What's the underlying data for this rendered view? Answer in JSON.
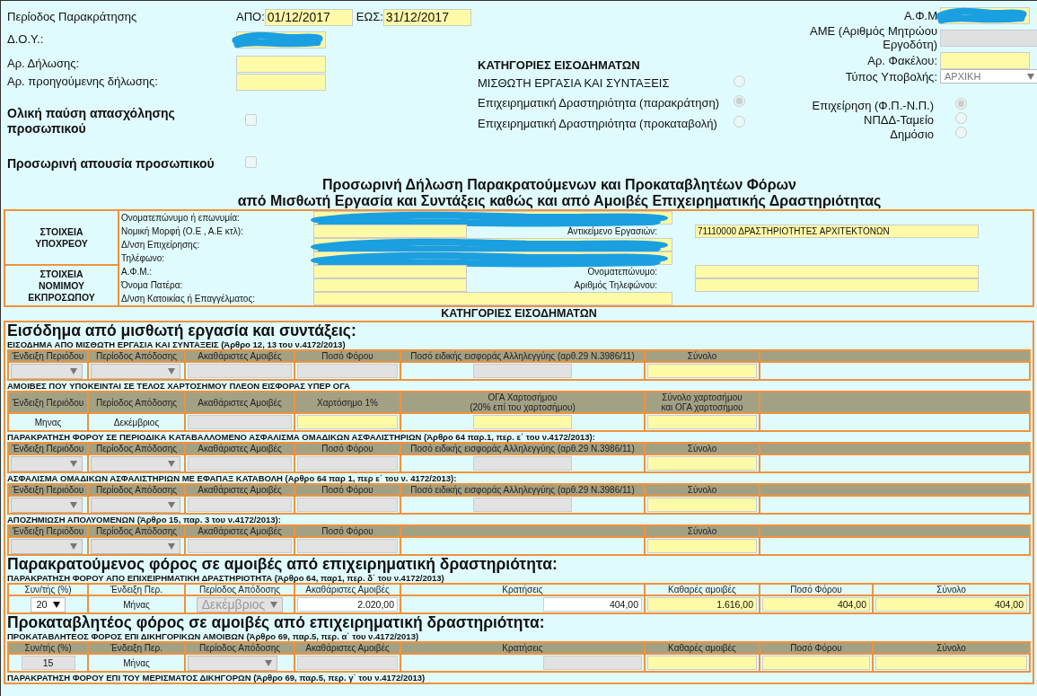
{
  "header": {
    "period": {
      "label": "Περίοδος Παρακράτησης",
      "from_label": "ΑΠΟ:",
      "from": "01/12/2017",
      "to_label": "ΕΩΣ:",
      "to": "31/12/2017"
    },
    "left_fields": [
      {
        "label": "Δ.Ο.Υ.:",
        "redacted": true
      },
      {
        "label": "Αρ. Δήλωσης:",
        "redacted": false
      },
      {
        "label": "Αρ. προηγούμενης δήλωσης:",
        "redacted": false
      }
    ],
    "checks": [
      {
        "label": "Ολική παύση απασχόλησης προσωπικού",
        "checked": false,
        "disabled": true
      },
      {
        "label": "Προσωρινή απουσία προσωπικού",
        "checked": false,
        "disabled": true
      }
    ],
    "categories": {
      "title": "ΚΑΤΗΓΟΡΙΕΣ ΕΙΣΟΔΗΜΑΤΩΝ",
      "options": [
        {
          "label": "ΜΙΣΘΩΤΗ ΕΡΓΑΣΙΑ ΚΑΙ ΣΥΝΤΑΞΕΙΣ",
          "selected": false,
          "disabled": true
        },
        {
          "label": "Επιχειρηματική Δραστηριότητα (παρακράτηση)",
          "selected": true,
          "disabled": true
        },
        {
          "label": "Επιχειρηματική Δραστηριότητα (προκαταβολή)",
          "selected": false,
          "disabled": true
        }
      ]
    },
    "right_fields": [
      {
        "label": "Α.Φ.Μ",
        "kind": "input",
        "redacted": true,
        "disabled": false
      },
      {
        "label": "ΑΜΕ (Αριθμός Μητρώου Εργοδότη)",
        "kind": "input",
        "redacted": false,
        "disabled": true
      },
      {
        "label": "Αρ. Φακέλου:",
        "kind": "input",
        "redacted": false,
        "disabled": false
      },
      {
        "label": "Τύπος Υποβολής:",
        "kind": "select",
        "value": "ΑΡΧΙΚΗ",
        "disabled": true
      }
    ],
    "entity_types": [
      {
        "label": "Επιχείρηση (Φ.Π.-Ν.Π.)",
        "selected": true,
        "disabled": true
      },
      {
        "label": "ΝΠΔΔ-Ταμείο",
        "selected": false,
        "disabled": true
      },
      {
        "label": "Δημόσιο",
        "selected": false,
        "disabled": true
      }
    ]
  },
  "title_lines": [
    "Προσωρινή Δήλωση Παρακρατούμενων και Προκαταβλητέων Φόρων",
    "από Μισθωτή Εργασία και Συντάξεις καθώς και από Αμοιβές Επιχειρηματικής Δραστηριότητας"
  ],
  "parties": [
    {
      "heading": "ΣΤΟΙΧΕΙΑ ΥΠΟΧΡΕΟΥ",
      "rows": [
        {
          "label": "Ονοματεπώνυμο ή επωνυμία:",
          "redacted": true
        },
        {
          "label": "Νομική Μορφή (Ο.Ε , Α.Ε κτλ):",
          "redacted": false,
          "label2": "Αντικείμενο Εργασιών:",
          "value2": "71110000 ΔΡΑΣΤΗΡΙΟΤΗΤΕΣ ΑΡΧΙΤΕΚΤΟΝΩΝ"
        },
        {
          "label": "Δ/νση Επιχείρησης:",
          "redacted": true
        },
        {
          "label": "Τηλέφωνο:",
          "redacted": true
        }
      ]
    },
    {
      "heading": "ΣΤΟΙΧΕΙΑ ΝΟΜΙΜΟΥ ΕΚΠΡΟΣΩΠΟΥ",
      "rows": [
        {
          "label": "Α.Φ.Μ.:",
          "redacted": false,
          "label2": "Ονοματεπώνυμο:"
        },
        {
          "label": "Όνομα Πατέρα:",
          "redacted": false,
          "label2": "Αριθμός Τηλεφώνου:"
        },
        {
          "label": "Δ/νση Κατοικίας ή Επαγγέλματος:",
          "redacted": false
        }
      ]
    }
  ],
  "income": {
    "title": "ΚΑΤΗΓΟΡΙΕΣ ΕΙΣΟΔΗΜΑΤΩΝ",
    "groups": [
      {
        "title": "Εισόδημα από μισθωτή εργασία και συντάξεις:",
        "sections": [
          {
            "caption": "ΕΙΣΟΔΗΜΑ ΑΠΟ ΜΙΣΘΩΤΗ ΕΡΓΑΣΙΑ ΚΑΙ ΣΥΝΤΑΞΕΙΣ (Άρθρο 12, 13 του ν.4172/2013)",
            "header_shaded": true,
            "columns": [
              "Ένδειξη Περιόδου",
              "Περίοδος Απόδοσης",
              "Ακαθάριστες Αμοιβές",
              "Ποσό Φόρου",
              "Ποσό ειδικής εισφοράς Αλληλεγγύης (αρθ.29 Ν.3986/11)",
              "Σύνολο"
            ],
            "cells": [
              {
                "kind": "select",
                "disabled": true
              },
              {
                "kind": "select",
                "disabled": true
              },
              {
                "kind": "input",
                "disabled": true,
                "highlighted": false
              },
              {
                "kind": "input",
                "disabled": true,
                "highlighted": false
              },
              {
                "kind": "input",
                "disabled": true,
                "highlighted": false
              },
              {
                "kind": "input",
                "disabled": false,
                "highlighted": true
              }
            ]
          },
          {
            "caption": "ΑΜΟΙΒΕΣ ΠΟΥ ΥΠΟΚΕΙΝΤΑΙ ΣΕ ΤΕΛΟΣ ΧΑΡΤΟΣΗΜΟΥ ΠΛΕΟΝ ΕΙΣΦΟΡΑΣ ΥΠΕΡ ΟΓΑ",
            "header_shaded": true,
            "columns": [
              "Ένδειξη Περιόδου",
              "Περίοδος Απόδοσης",
              "Ακαθάριστες Αμοιβές",
              "Χαρτόσημο 1%",
              "ΟΓΑ Χαρτοσήμου\n(20% επί του χαρτοσήμου)",
              "Σύνολο χαρτοσήμου\nκαι ΟΓΑ χαρτοσήμου"
            ],
            "cells": [
              {
                "kind": "text",
                "value": "Μηνας"
              },
              {
                "kind": "text",
                "value": "Δεκέμβριος"
              },
              {
                "kind": "input",
                "disabled": true,
                "highlighted": false
              },
              {
                "kind": "input",
                "disabled": false,
                "highlighted": true
              },
              {
                "kind": "input",
                "disabled": false,
                "highlighted": true
              },
              {
                "kind": "input",
                "disabled": false,
                "highlighted": true
              }
            ]
          },
          {
            "caption": "ΠΑΡΑΚΡΑΤΗΣΗ ΦΟΡΟΥ ΣΕ ΠΕΡΙΟΔΙΚΑ ΚΑΤΑΒΑΛΛΟΜΕΝΟ ΑΣΦΑΛΙΣΜΑ ΟΜΑΔΙΚΩΝ ΑΣΦΑΛΙΣΤΗΡΙΩΝ (Άρθρο 64 παρ.1, περ. ε΄ του ν.4172/2013):",
            "header_shaded": true,
            "columns": [
              "Ένδειξη Περιόδου",
              "Περίοδος Απόδοσης",
              "Ακαθάριστες Αμοιβές",
              "Ποσό Φόρου",
              "Ποσό ειδικής εισφοράς Αλληλεγγύης (αρθ.29 Ν.3986/11)",
              "Σύνολο"
            ],
            "cells": [
              {
                "kind": "select",
                "disabled": true
              },
              {
                "kind": "select",
                "disabled": true
              },
              {
                "kind": "input",
                "disabled": true,
                "highlighted": false
              },
              {
                "kind": "input",
                "disabled": true,
                "highlighted": false
              },
              {
                "kind": "input",
                "disabled": true,
                "highlighted": false
              },
              {
                "kind": "input",
                "disabled": false,
                "highlighted": true
              }
            ]
          },
          {
            "caption": "ΑΣΦΑΛΙΣΜΑ ΟΜΑΔΙΚΩΝ ΑΣΦΑΛΙΣΤΗΡΙΩΝ ΜΕ ΕΦΑΠΑΞ ΚΑΤΑΒΟΛΗ (Αρθρο 64 παρ 1, περ ε΄ του ν. 4172/2013):",
            "header_shaded": true,
            "columns": [
              "Ένδειξη Περιόδου",
              "Περίοδος Απόδοσης",
              "Ακαθάριστες Αμοιβές",
              "Ποσό Φόρου",
              "Ποσό ειδικής εισφοράς Αλληλεγγύης (αρθ.29 Ν.3986/11)",
              "Σύνολο"
            ],
            "cells": [
              {
                "kind": "select",
                "disabled": true
              },
              {
                "kind": "select",
                "disabled": true
              },
              {
                "kind": "input",
                "disabled": true,
                "highlighted": false
              },
              {
                "kind": "input",
                "disabled": true,
                "highlighted": false
              },
              {
                "kind": "input",
                "disabled": true,
                "highlighted": false
              },
              {
                "kind": "input",
                "disabled": false,
                "highlighted": true
              }
            ]
          },
          {
            "caption": "ΑΠΟΖΗΜΙΩΣΗ ΑΠΟΛΥΟΜΕΝΩΝ (Άρθρο 15, παρ. 3 του ν.4172/2013):",
            "header_shaded": true,
            "columns": [
              "Ένδειξη Περιόδου",
              "Περίοδος Απόδοσης",
              "Ακαθάριστες Αμοιβές",
              "Ποσό Φόρου",
              null,
              "Σύνολο"
            ],
            "cells": [
              {
                "kind": "select",
                "disabled": true
              },
              {
                "kind": "select",
                "disabled": true
              },
              {
                "kind": "input",
                "disabled": true,
                "highlighted": false
              },
              {
                "kind": "input",
                "disabled": true,
                "highlighted": false
              },
              {
                "kind": "none"
              },
              {
                "kind": "input",
                "disabled": false,
                "highlighted": true
              }
            ]
          }
        ]
      },
      {
        "title": "Παρακρατούμενος φόρος σε αμοιβές από επιχειρηματική δραστηριότητα:",
        "sections": [
          {
            "caption": "ΠΑΡΑΚΡΑΤΗΣΗ ΦΟΡΟΥ ΑΠΟ ΕΠΙΧΕΙΡΗΜΑΤΙΚΗ ΔΡΑΣΤΗΡΙΟΤΗΤΑ (Άρθρο 64, παρ1, περ. δ΄ του ν.4172/2013)",
            "header_shaded": false,
            "columns": [
              "Συν/τής (%)",
              "Ένδειξη Περ.",
              "Περίοδος Απόδοσης",
              "Ακαθάριστες Αμοιβές",
              "Κρατήσεις",
              "Καθαρές αμοιβές",
              "Ποσό Φόρου",
              "Σύνολο"
            ],
            "cells": [
              {
                "kind": "select",
                "disabled": false,
                "value": "20"
              },
              {
                "kind": "text",
                "value": "Μήνας"
              },
              {
                "kind": "select",
                "disabled": true,
                "value": "Δεκέμβριος"
              },
              {
                "kind": "input",
                "disabled": false,
                "highlighted": false,
                "value": "2.020,00"
              },
              {
                "kind": "input",
                "disabled": false,
                "highlighted": false,
                "value": "404,00"
              },
              {
                "kind": "input",
                "disabled": false,
                "highlighted": true,
                "value": "1.616,00"
              },
              {
                "kind": "input",
                "disabled": false,
                "highlighted": true,
                "value": "404,00"
              },
              {
                "kind": "input",
                "disabled": false,
                "highlighted": true,
                "value": "404,00"
              }
            ]
          }
        ]
      },
      {
        "title": "Προκαταβλητέος φόρος σε αμοιβές από επιχειρηματική δραστηριότητα:",
        "sections": [
          {
            "caption": "ΠΡΟΚΑΤΑΒΛΗΤΕΟΣ ΦΟΡΟΣ ΕΠΙ ΔΙΚΗΓΟΡΙΚΩΝ ΑΜΟΙΒΩΝ (Άρθρο 69, παρ.5, περ. α΄ του ν.4172/2013)",
            "header_shaded": true,
            "columns": [
              "Συν/τής (%)",
              "Ένδειξη Περ.",
              "Περίοδος Απόδοσης",
              "Ακαθάριστες Αμοιβές",
              "Κρατήσεις",
              "Καθαρές αμοιβές",
              "Ποσό Φόρου",
              "Σύνολο"
            ],
            "cells": [
              {
                "kind": "input",
                "disabled": true,
                "highlighted": false,
                "value": "15"
              },
              {
                "kind": "text",
                "value": "Μήνας"
              },
              {
                "kind": "select",
                "disabled": true
              },
              {
                "kind": "input",
                "disabled": true,
                "highlighted": false
              },
              {
                "kind": "input",
                "disabled": true,
                "highlighted": false
              },
              {
                "kind": "input",
                "disabled": false,
                "highlighted": true
              },
              {
                "kind": "input",
                "disabled": false,
                "highlighted": true
              },
              {
                "kind": "input",
                "disabled": false,
                "highlighted": true
              }
            ]
          },
          {
            "caption": "ΠΑΡΑΚΡΑΤΗΣΗ ΦΟΡΟΥ ΕΠΙ ΤΟΥ ΜΕΡΙΣΜΑΤΟΣ ΔΙΚΗΓΟΡΩΝ (Άρθρο 69, παρ.5, περ. γ΄ του ν.4172/2013)"
          }
        ]
      }
    ]
  }
}
